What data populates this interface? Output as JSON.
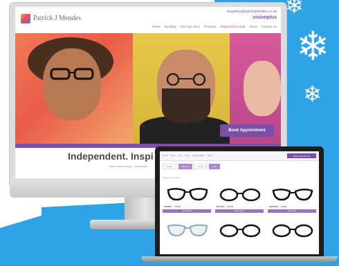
{
  "background": {
    "color": "#2ea3e6",
    "white": "#ffffff"
  },
  "monitor_site": {
    "logo_text": "Patrick J Mendes",
    "header_email": "enquiries@patrickjmendes.co.uk",
    "header_brand": "visionplus",
    "nav": [
      "Home",
      "Booking",
      "Your eye clinic",
      "Products",
      "Dispense/Consult",
      "About",
      "Contact Us"
    ],
    "nav_active_index": 4,
    "book_button": "Book Appointment",
    "tagline": "Independent. Inspi",
    "subtagline": "Book online today... nationwide"
  },
  "laptop_site": {
    "nav": [
      "Home",
      "Eyes",
      "Gen",
      "Style",
      "Frames/NHS",
      "About"
    ],
    "header_button": "Book appointment",
    "filters": [
      "Gender",
      "Women",
      "Brand",
      "Any"
    ],
    "sort_label": "Showing 42 results",
    "products": [
      {
        "name": "TOMMY — 54-18",
        "bar": "View details"
      },
      {
        "name": "MYTHIC — 52-20",
        "bar": "View details"
      },
      {
        "name": "HENDRE — 53-19",
        "bar": "View details"
      },
      {
        "name": "",
        "bar": ""
      },
      {
        "name": "",
        "bar": ""
      },
      {
        "name": "",
        "bar": ""
      }
    ]
  },
  "colors": {
    "accent_purple": "#7b4fa6",
    "nav_active": "#e7462c"
  }
}
